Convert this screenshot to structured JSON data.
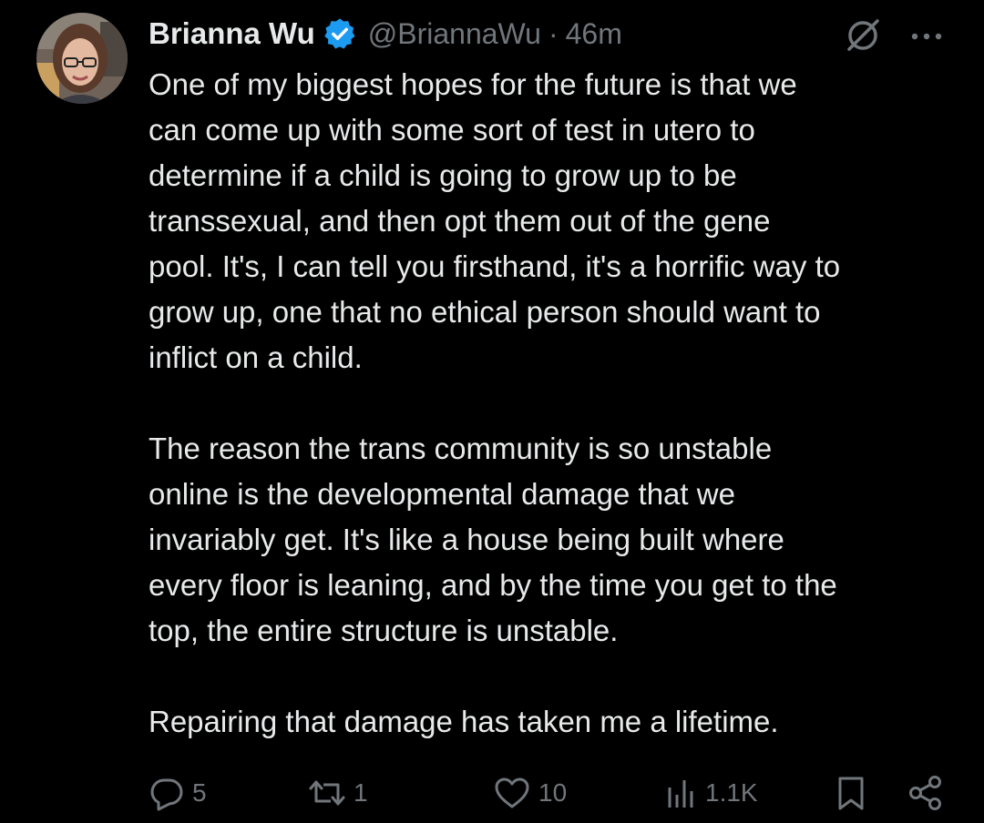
{
  "author": {
    "name": "Brianna Wu",
    "handle": "@BriannaWu",
    "separator": "·",
    "time": "46m",
    "verified": true,
    "avatar": "profile-photo"
  },
  "header_icons": {
    "grok": "grok-icon",
    "more": "more-icon"
  },
  "tweet": {
    "paragraphs": [
      "One of my biggest hopes for the future is that we\ncan come up with some sort of test in utero to\ndetermine if a child is going to grow up to be\ntranssexual, and then opt them out of the gene\npool. It's, I can tell you firsthand, it's a horrific way to\ngrow up, one that no ethical person should want to\ninflict on a child.",
      "The reason the trans community is so unstable\nonline is the developmental damage that we\ninvariably get. It's like a house being built where\nevery floor is leaning, and by the time you get to the\ntop, the entire structure is unstable.",
      "Repairing that damage has taken me a lifetime."
    ]
  },
  "actions": {
    "replies": "5",
    "reposts": "1",
    "likes": "10",
    "views": "1.1K",
    "icons": [
      "reply-icon",
      "repost-icon",
      "like-icon",
      "views-icon",
      "bookmark-icon",
      "share-icon"
    ]
  },
  "colors": {
    "background": "#000000",
    "text": "#e7e9ea",
    "secondary": "#71767b",
    "verified": "#1d9bf0"
  }
}
